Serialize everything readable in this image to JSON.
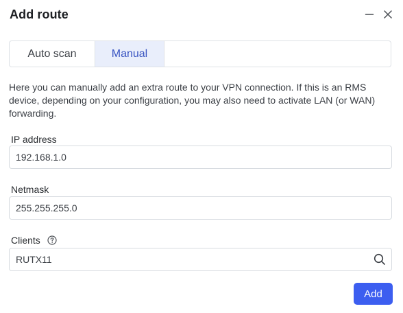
{
  "dialog": {
    "title": "Add route",
    "minimize_icon": "minus-icon",
    "close_icon": "close-icon"
  },
  "tabs": [
    {
      "label": "Auto scan",
      "active": false
    },
    {
      "label": "Manual",
      "active": true
    }
  ],
  "description": "Here you can manually add an extra route to your VPN connection. If this is an RMS device, depending on your configuration, you may also need to activate LAN (or WAN) forwarding.",
  "fields": {
    "ip": {
      "label": "IP address",
      "value": "192.168.1.0"
    },
    "netmask": {
      "label": "Netmask",
      "value": "255.255.255.0"
    },
    "clients": {
      "label": "Clients",
      "value": "RUTX11",
      "help_icon": "help-circle-icon",
      "action_icon": "search-icon"
    }
  },
  "actions": {
    "add_label": "Add"
  },
  "colors": {
    "accent": "#3c5ef0",
    "active_tab_bg": "#e9eefb",
    "active_tab_text": "#3a55c2"
  }
}
